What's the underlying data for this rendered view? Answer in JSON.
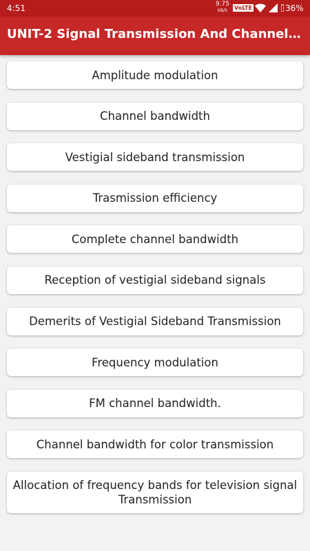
{
  "status_bar": {
    "time": "4:51",
    "net_speed": "9.75",
    "net_unit": "KB/S",
    "volte": "VoLTE",
    "battery": "36%"
  },
  "app_bar": {
    "title": "UNIT-2 Signal Transmission And Channel B..."
  },
  "topics": [
    {
      "label": "Amplitude modulation"
    },
    {
      "label": "Channel bandwidth"
    },
    {
      "label": "Vestigial sideband transmission"
    },
    {
      "label": "Trasmission efficiency"
    },
    {
      "label": "Complete channel bandwidth"
    },
    {
      "label": "Reception of vestigial sideband signals"
    },
    {
      "label": "Demerits of Vestigial Sideband Transmission"
    },
    {
      "label": "Frequency modulation"
    },
    {
      "label": "FM channel bandwidth."
    },
    {
      "label": "Channel bandwidth for color transmission"
    },
    {
      "label": "Allocation of frequency bands for television signal Transmission"
    }
  ],
  "colors": {
    "app_bar": "#c62828",
    "status_bar": "#b71c1c",
    "background": "#f2f2f2",
    "card": "#ffffff"
  }
}
